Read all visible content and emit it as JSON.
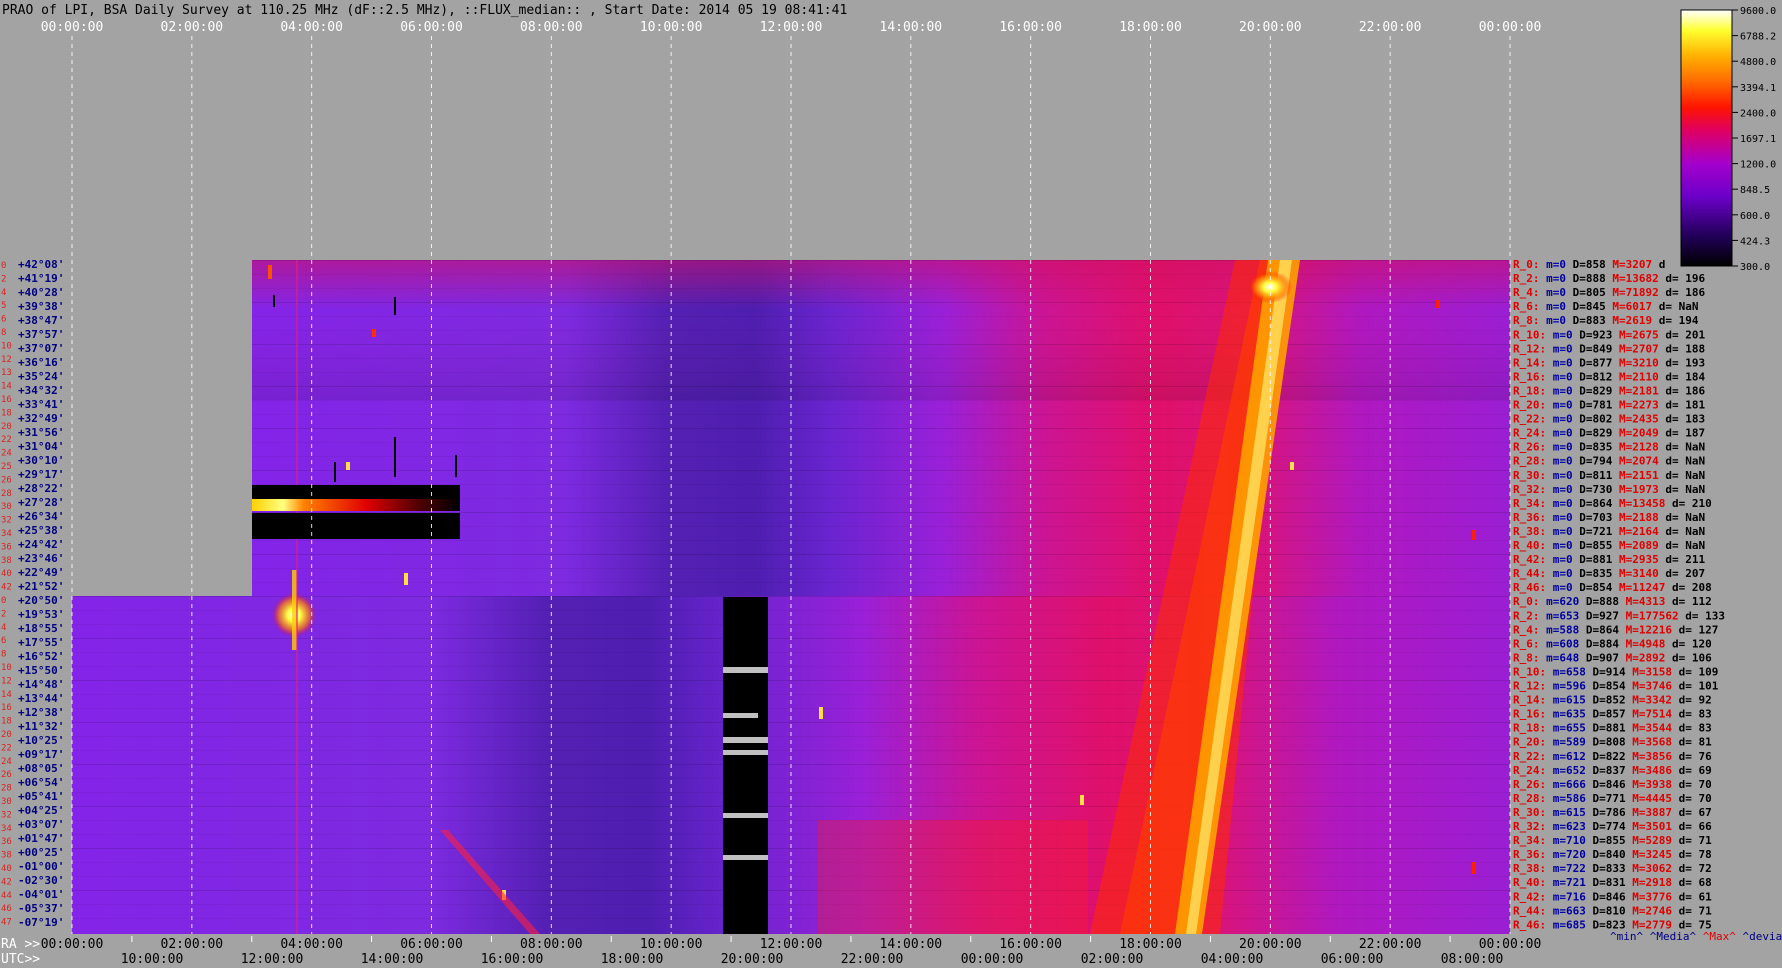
{
  "title": "PRAO of LPI, BSA Daily Survey at 110.25 MHz (dF::2.5 MHz), ::FLUX_median:: , Start Date: 2014 05 19 08:41:41",
  "colors": {
    "background": "#a3a3a3",
    "title_text": "#000000",
    "top_time_text": "#ffffff",
    "dec_index_text": "#e02020",
    "dec_value_text": "#000080",
    "stat_r": "#e00000",
    "stat_m": "#0000a0",
    "stat_d": "#000000",
    "stat_max": "#e00000",
    "grid": "#ffffff"
  },
  "chart_data": {
    "type": "heatmap",
    "title": "PRAO of LPI, BSA Daily Survey at 110.25 MHz (dF::2.5 MHz), ::FLUX_median:: , Start Date: 2014 05 19 08:41:41",
    "colormap": "black-purple-red-yellow-white",
    "colorbar": {
      "ticks": [
        "9600.0",
        "6788.2",
        "4800.0",
        "3394.1",
        "2400.0",
        "1697.1",
        "1200.0",
        "848.5",
        "600.0",
        "424.3",
        "300.0"
      ],
      "range": [
        300,
        9600
      ],
      "scale": "log"
    },
    "x_top_ticks": [
      "00:00:00",
      "02:00:00",
      "04:00:00",
      "06:00:00",
      "08:00:00",
      "10:00:00",
      "12:00:00",
      "14:00:00",
      "16:00:00",
      "18:00:00",
      "20:00:00",
      "22:00:00",
      "00:00:00"
    ],
    "x_ra_label": "RA >>",
    "x_ra_ticks": [
      "00:00:00",
      "02:00:00",
      "04:00:00",
      "06:00:00",
      "08:00:00",
      "10:00:00",
      "12:00:00",
      "14:00:00",
      "16:00:00",
      "18:00:00",
      "20:00:00",
      "22:00:00",
      "00:00:00"
    ],
    "x_utc_label": "UTC>>",
    "x_utc_ticks": [
      "10:00:00",
      "12:00:00",
      "14:00:00",
      "16:00:00",
      "18:00:00",
      "20:00:00",
      "22:00:00",
      "00:00:00",
      "02:00:00",
      "04:00:00",
      "06:00:00",
      "08:00:00"
    ],
    "declinations": [
      "+42°08'",
      "+41°19'",
      "+40°28'",
      "+39°38'",
      "+38°47'",
      "+37°57'",
      "+37°07'",
      "+36°16'",
      "+35°24'",
      "+34°32'",
      "+33°41'",
      "+32°49'",
      "+31°56'",
      "+31°04'",
      "+30°10'",
      "+29°17'",
      "+28°22'",
      "+27°28'",
      "+26°34'",
      "+25°38'",
      "+24°42'",
      "+23°46'",
      "+22°49'",
      "+21°52'",
      "+20°50'",
      "+19°53'",
      "+18°55'",
      "+17°55'",
      "+16°52'",
      "+15°50'",
      "+14°48'",
      "+13°44'",
      "+12°38'",
      "+11°32'",
      "+10°25'",
      "+09°17'",
      "+08°05'",
      "+06°54'",
      "+05°41'",
      "+04°25'",
      "+03°07'",
      "+01°47'",
      "+00°25'",
      "-01°00'",
      "-02°30'",
      "-04°01'",
      "-05°37'",
      "-07°19'"
    ],
    "left_indices": [
      "0",
      "2",
      "4",
      "5",
      "6",
      "8",
      "10",
      "12",
      "13",
      "14",
      "16",
      "18",
      "20",
      "22",
      "24",
      "25",
      "26",
      "28",
      "30",
      "32",
      "34",
      "36",
      "38",
      "40",
      "42",
      "0",
      "2",
      "4",
      "6",
      "8",
      "10",
      "12",
      "14",
      "16",
      "18",
      "20",
      "22",
      "24",
      "26",
      "28",
      "30",
      "32",
      "34",
      "36",
      "38",
      "40",
      "42",
      "44",
      "46",
      "47"
    ],
    "stats": [
      {
        "r": "R_0:",
        "m": "m=0",
        "d": "D=858",
        "max": "M=3207",
        "dev": "d"
      },
      {
        "r": "R_2:",
        "m": "m=0",
        "d": "D=888",
        "max": "M=13682",
        "dev": "d= 196"
      },
      {
        "r": "R_4:",
        "m": "m=0",
        "d": "D=805",
        "max": "M=71892",
        "dev": "d= 186"
      },
      {
        "r": "R_6:",
        "m": "m=0",
        "d": "D=845",
        "max": "M=6017",
        "dev": "d= NaN"
      },
      {
        "r": "R_8:",
        "m": "m=0",
        "d": "D=883",
        "max": "M=2619",
        "dev": "d= 194"
      },
      {
        "r": "R_10:",
        "m": "m=0",
        "d": "D=923",
        "max": "M=2675",
        "dev": "d= 201"
      },
      {
        "r": "R_12:",
        "m": "m=0",
        "d": "D=849",
        "max": "M=2707",
        "dev": "d= 188"
      },
      {
        "r": "R_14:",
        "m": "m=0",
        "d": "D=877",
        "max": "M=3210",
        "dev": "d= 193"
      },
      {
        "r": "R_16:",
        "m": "m=0",
        "d": "D=812",
        "max": "M=2110",
        "dev": "d= 184"
      },
      {
        "r": "R_18:",
        "m": "m=0",
        "d": "D=829",
        "max": "M=2181",
        "dev": "d= 186"
      },
      {
        "r": "R_20:",
        "m": "m=0",
        "d": "D=781",
        "max": "M=2273",
        "dev": "d= 181"
      },
      {
        "r": "R_22:",
        "m": "m=0",
        "d": "D=802",
        "max": "M=2435",
        "dev": "d= 183"
      },
      {
        "r": "R_24:",
        "m": "m=0",
        "d": "D=829",
        "max": "M=2049",
        "dev": "d= 187"
      },
      {
        "r": "R_26:",
        "m": "m=0",
        "d": "D=835",
        "max": "M=2128",
        "dev": "d= NaN"
      },
      {
        "r": "R_28:",
        "m": "m=0",
        "d": "D=794",
        "max": "M=2074",
        "dev": "d= NaN"
      },
      {
        "r": "R_30:",
        "m": "m=0",
        "d": "D=811",
        "max": "M=2151",
        "dev": "d= NaN"
      },
      {
        "r": "R_32:",
        "m": "m=0",
        "d": "D=730",
        "max": "M=1973",
        "dev": "d= NaN"
      },
      {
        "r": "R_34:",
        "m": "m=0",
        "d": "D=864",
        "max": "M=13458",
        "dev": "d= 210"
      },
      {
        "r": "R_36:",
        "m": "m=0",
        "d": "D=703",
        "max": "M=2188",
        "dev": "d= NaN"
      },
      {
        "r": "R_38:",
        "m": "m=0",
        "d": "D=721",
        "max": "M=2164",
        "dev": "d= NaN"
      },
      {
        "r": "R_40:",
        "m": "m=0",
        "d": "D=855",
        "max": "M=2089",
        "dev": "d= NaN"
      },
      {
        "r": "R_42:",
        "m": "m=0",
        "d": "D=881",
        "max": "M=2935",
        "dev": "d= 211"
      },
      {
        "r": "R_44:",
        "m": "m=0",
        "d": "D=835",
        "max": "M=3140",
        "dev": "d= 207"
      },
      {
        "r": "R_46:",
        "m": "m=0",
        "d": "D=854",
        "max": "M=11247",
        "dev": "d= 208"
      },
      {
        "r": "R_0:",
        "m": "m=620",
        "d": "D=888",
        "max": "M=4313",
        "dev": "d= 112"
      },
      {
        "r": "R_2:",
        "m": "m=653",
        "d": "D=927",
        "max": "M=177562",
        "dev": "d= 133"
      },
      {
        "r": "R_4:",
        "m": "m=588",
        "d": "D=864",
        "max": "M=12216",
        "dev": "d= 127"
      },
      {
        "r": "R_6:",
        "m": "m=608",
        "d": "D=884",
        "max": "M=4948",
        "dev": "d= 120"
      },
      {
        "r": "R_8:",
        "m": "m=648",
        "d": "D=907",
        "max": "M=2892",
        "dev": "d= 106"
      },
      {
        "r": "R_10:",
        "m": "m=658",
        "d": "D=914",
        "max": "M=3158",
        "dev": "d= 109"
      },
      {
        "r": "R_12:",
        "m": "m=596",
        "d": "D=854",
        "max": "M=3746",
        "dev": "d= 101"
      },
      {
        "r": "R_14:",
        "m": "m=615",
        "d": "D=852",
        "max": "M=3342",
        "dev": "d= 92"
      },
      {
        "r": "R_16:",
        "m": "m=635",
        "d": "D=857",
        "max": "M=7514",
        "dev": "d= 83"
      },
      {
        "r": "R_18:",
        "m": "m=655",
        "d": "D=881",
        "max": "M=3544",
        "dev": "d= 83"
      },
      {
        "r": "R_20:",
        "m": "m=589",
        "d": "D=808",
        "max": "M=3568",
        "dev": "d= 81"
      },
      {
        "r": "R_22:",
        "m": "m=612",
        "d": "D=822",
        "max": "M=3856",
        "dev": "d= 76"
      },
      {
        "r": "R_24:",
        "m": "m=652",
        "d": "D=837",
        "max": "M=3486",
        "dev": "d= 69"
      },
      {
        "r": "R_26:",
        "m": "m=666",
        "d": "D=846",
        "max": "M=3938",
        "dev": "d= 70"
      },
      {
        "r": "R_28:",
        "m": "m=586",
        "d": "D=771",
        "max": "M=4445",
        "dev": "d= 70"
      },
      {
        "r": "R_30:",
        "m": "m=615",
        "d": "D=786",
        "max": "M=3887",
        "dev": "d= 67"
      },
      {
        "r": "R_32:",
        "m": "m=623",
        "d": "D=774",
        "max": "M=3501",
        "dev": "d= 66"
      },
      {
        "r": "R_34:",
        "m": "m=710",
        "d": "D=855",
        "max": "M=5289",
        "dev": "d= 71"
      },
      {
        "r": "R_36:",
        "m": "m=720",
        "d": "D=840",
        "max": "M=3245",
        "dev": "d= 78"
      },
      {
        "r": "R_38:",
        "m": "m=722",
        "d": "D=833",
        "max": "M=3062",
        "dev": "d= 72"
      },
      {
        "r": "R_40:",
        "m": "m=721",
        "d": "D=831",
        "max": "M=2918",
        "dev": "d= 68"
      },
      {
        "r": "R_42:",
        "m": "m=716",
        "d": "D=846",
        "max": "M=3776",
        "dev": "d= 61"
      },
      {
        "r": "R_44:",
        "m": "m=663",
        "d": "D=810",
        "max": "M=2746",
        "dev": "d= 71"
      },
      {
        "r": "R_46:",
        "m": "m=685",
        "d": "D=823",
        "max": "M=2779",
        "dev": "d= 75"
      }
    ],
    "stats_footer": [
      "^min^",
      "^Media^",
      "^Max^",
      "^devia^"
    ]
  }
}
